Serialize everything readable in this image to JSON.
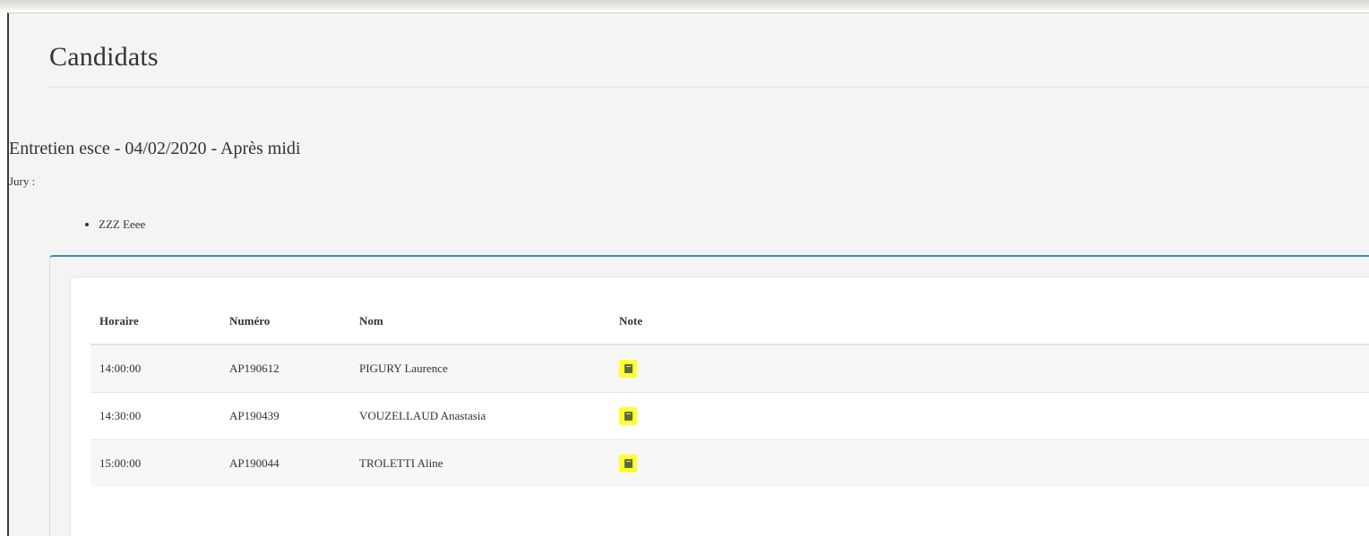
{
  "page": {
    "title": "Candidats"
  },
  "session": {
    "title": "Entretien esce - 04/02/2020 - Après midi",
    "jury_label": "Jury :",
    "jury_members": [
      "ZZZ Eeee"
    ]
  },
  "table": {
    "headers": {
      "horaire": "Horaire",
      "numero": "Numéro",
      "nom": "Nom",
      "note": "Note"
    },
    "rows": [
      {
        "horaire": "14:00:00",
        "numero": "AP190612",
        "nom": "PIGURY Laurence",
        "note_icon": "notebook-icon"
      },
      {
        "horaire": "14:30:00",
        "numero": "AP190439",
        "nom": "VOUZELLAUD Anastasia",
        "note_icon": "notebook-icon"
      },
      {
        "horaire": "15:00:00",
        "numero": "AP190044",
        "nom": "TROLETTI Aline",
        "note_icon": "notebook-icon"
      }
    ]
  },
  "colors": {
    "panel_accent": "#3c8dbc",
    "note_highlight": "#ffff33"
  }
}
